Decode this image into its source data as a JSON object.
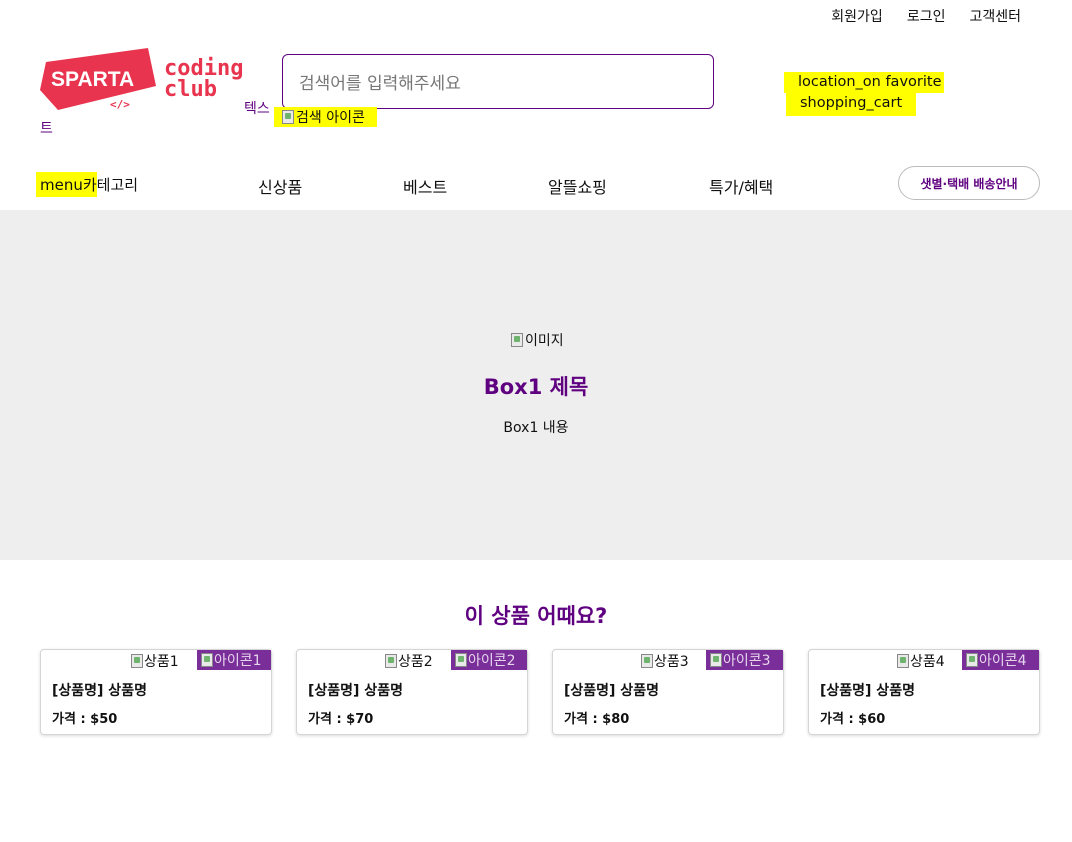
{
  "top_links": [
    "회원가입",
    "로그인",
    "고객센터"
  ],
  "logo": {
    "main": "SPARTA",
    "sub1": "coding",
    "sub2": "club",
    "mark": "</>",
    "alt_part1": "텍스",
    "alt_part2": "트",
    "colors": {
      "red": "#e8344e",
      "purple": "#5f0080"
    }
  },
  "search": {
    "placeholder": "검색어를 입력해주세요",
    "icon_alt": "검색 아이콘"
  },
  "header_icons": {
    "line1": "location_on favorite",
    "line2": "shopping_cart"
  },
  "nav": {
    "menu_icon_text": "menu",
    "category_label_hl": "카",
    "category_label_rest": "테고리",
    "items": [
      "신상품",
      "베스트",
      "알뜰쇼핑",
      "특가/혜택"
    ],
    "delivery_button": "샛별·택배 배송안내"
  },
  "banner": {
    "img_alt": "이미지",
    "title": "Box1 제목",
    "content": "Box1 내용"
  },
  "products": {
    "title": "이 상품 어때요?",
    "items": [
      {
        "img_alt": "상품1",
        "icon_alt": "아이콘1",
        "name": "[상품명] 상품명",
        "price": "가격 : $50"
      },
      {
        "img_alt": "상품2",
        "icon_alt": "아이콘2",
        "name": "[상품명] 상품명",
        "price": "가격 : $70"
      },
      {
        "img_alt": "상품3",
        "icon_alt": "아이콘3",
        "name": "[상품명] 상품명",
        "price": "가격 : $80"
      },
      {
        "img_alt": "상품4",
        "icon_alt": "아이콘4",
        "name": "[상품명] 상품명",
        "price": "가격 : $60"
      }
    ]
  },
  "colors": {
    "accent": "#5f0080",
    "highlight": "#ffff00",
    "banner_bg": "#eeeeee",
    "badge": "#7a2e9a"
  }
}
